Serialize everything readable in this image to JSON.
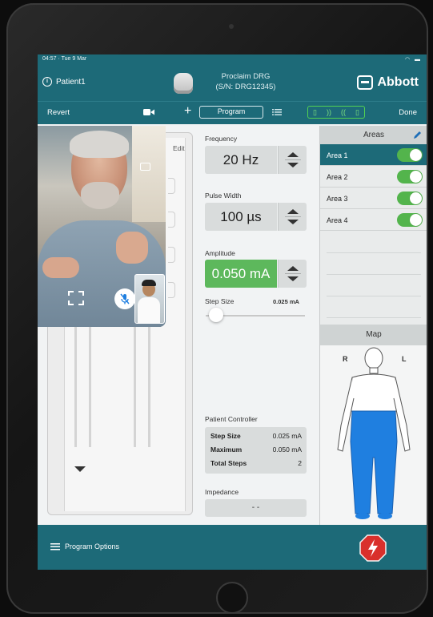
{
  "status_bar": {
    "time": "04:57 · Tue 9 Mar",
    "system_icons": "wifi-battery"
  },
  "header": {
    "patient_label": "Patient1",
    "device_name": "Proclaim DRG",
    "device_serial": "(S/N: DRG12345)",
    "brand": "Abbott"
  },
  "toolbar": {
    "revert_label": "Revert",
    "program_label": "Program",
    "done_label": "Done",
    "status_icons": "battery-signal-status"
  },
  "lead_panel": {
    "edit_label": "Edit"
  },
  "controls": {
    "frequency": {
      "label": "Frequency",
      "value": "20 Hz"
    },
    "pulse_width": {
      "label": "Pulse Width",
      "value": "100 µs"
    },
    "amplitude": {
      "label": "Amplitude",
      "value": "0.050 mA"
    },
    "step_size": {
      "label": "Step Size",
      "value": "0.025 mA",
      "slider_level": 0.05
    }
  },
  "patient_controller": {
    "title": "Patient Controller",
    "rows": [
      {
        "key": "Step Size",
        "value": "0.025 mA"
      },
      {
        "key": "Maximum",
        "value": "0.050 mA"
      },
      {
        "key": "Total Steps",
        "value": "2"
      }
    ]
  },
  "impedance": {
    "label": "Impedance",
    "value": "- -"
  },
  "areas": {
    "title": "Areas",
    "items": [
      {
        "label": "Area 1",
        "enabled": true,
        "selected": true
      },
      {
        "label": "Area 2",
        "enabled": true,
        "selected": false
      },
      {
        "label": "Area 3",
        "enabled": true,
        "selected": false
      },
      {
        "label": "Area 4",
        "enabled": true,
        "selected": false
      }
    ]
  },
  "map": {
    "title": "Map",
    "right_label": "R",
    "left_label": "L"
  },
  "bottom_bar": {
    "program_options_label": "Program Options"
  },
  "colors": {
    "teal": "#1d6a78",
    "green": "#5db85c",
    "toggle_green": "#53b44c",
    "map_blue": "#1f7fe0",
    "stop_red": "#d9302c"
  }
}
